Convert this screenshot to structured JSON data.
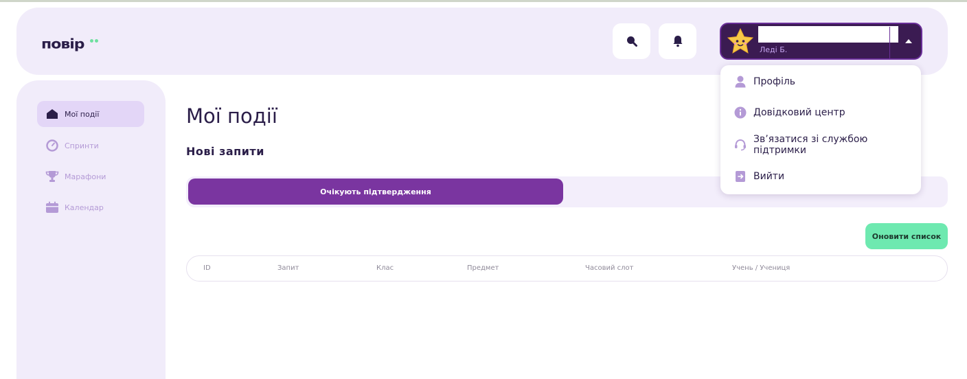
{
  "app": {
    "logo_text": "повір"
  },
  "header": {
    "user": {
      "name": "",
      "subtitle": "Леді Б."
    }
  },
  "sidebar": {
    "items": [
      {
        "label": "Мої події",
        "icon": "home-icon",
        "active": true
      },
      {
        "label": "Спринти",
        "icon": "gauge-icon",
        "active": false
      },
      {
        "label": "Марафони",
        "icon": "trophy-icon",
        "active": false
      },
      {
        "label": "Календар",
        "icon": "calendar-icon",
        "active": false
      }
    ]
  },
  "main": {
    "title": "Мої події",
    "section_title": "Нові запити",
    "tabs": [
      {
        "label": "Очікують підтвердження",
        "active": true
      },
      {
        "label": "",
        "active": false
      }
    ],
    "refresh_label": "Оновити список",
    "table": {
      "columns": [
        "ID",
        "Запит",
        "Клас",
        "Предмет",
        "Часовий слот",
        "Учень / Учениця"
      ]
    }
  },
  "dropdown": {
    "items": [
      {
        "label": "Профіль",
        "icon": "user-icon"
      },
      {
        "label": "Довідковий центр",
        "icon": "info-icon"
      },
      {
        "label": "Зв’язатися зі службою підтримки",
        "icon": "headset-icon"
      },
      {
        "label": "Вийти",
        "icon": "logout-icon"
      }
    ]
  },
  "colors": {
    "accent": "#7a35a0",
    "user_card": "#3b1b52",
    "refresh": "#6ee9b0",
    "panel": "#f1ecfa"
  }
}
